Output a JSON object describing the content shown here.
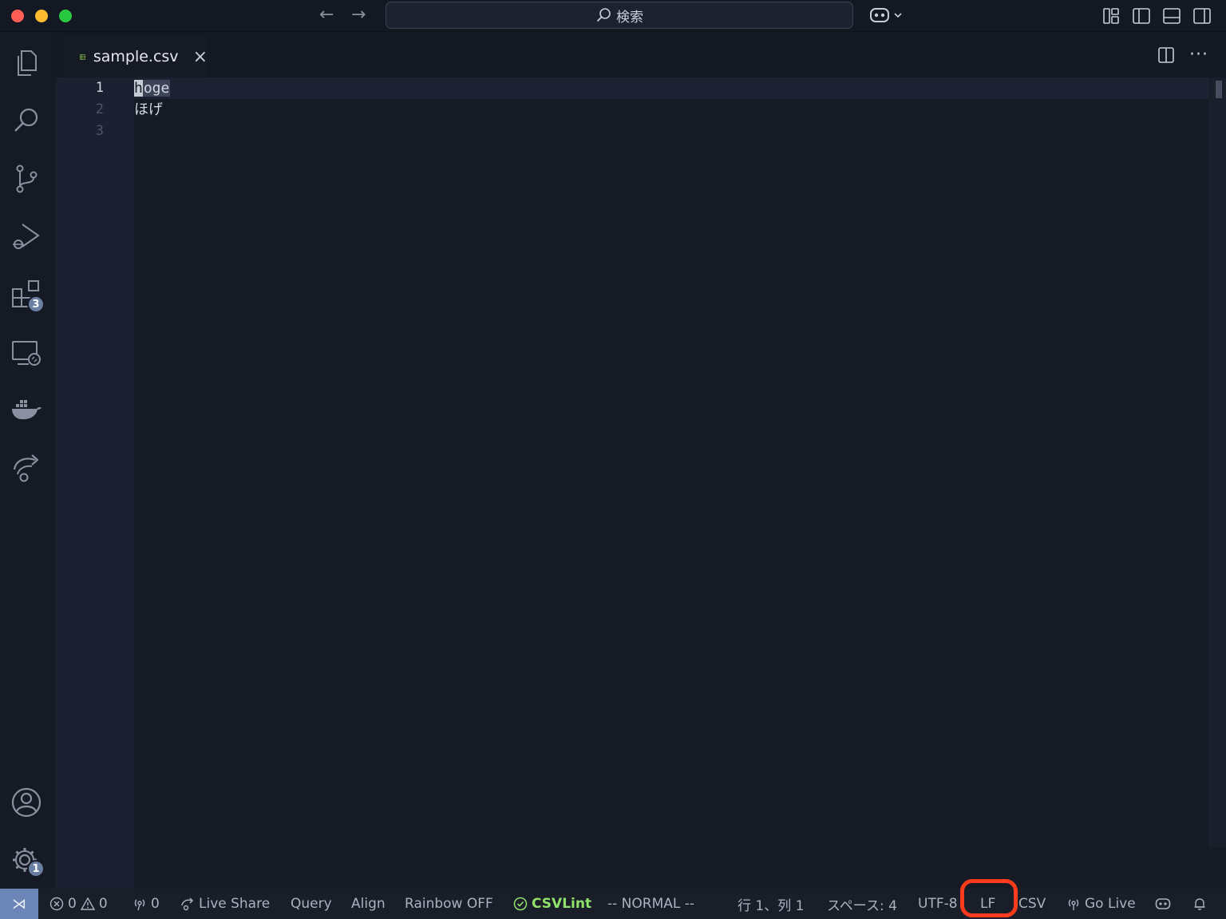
{
  "titlebar": {
    "search_label": "検索",
    "back_icon": "arrow-left-icon",
    "forward_icon": "arrow-right-icon"
  },
  "activity_bar": {
    "items": [
      {
        "name": "explorer",
        "icon": "files-icon"
      },
      {
        "name": "search",
        "icon": "search-icon"
      },
      {
        "name": "source-control",
        "icon": "git-branch-icon"
      },
      {
        "name": "run-debug",
        "icon": "debug-icon"
      },
      {
        "name": "extensions",
        "icon": "extensions-icon",
        "badge": "3"
      },
      {
        "name": "remote-explorer",
        "icon": "remote-explorer-icon"
      },
      {
        "name": "docker",
        "icon": "docker-icon"
      },
      {
        "name": "live-share",
        "icon": "live-share-icon"
      }
    ],
    "bottom": [
      {
        "name": "accounts",
        "icon": "account-icon"
      },
      {
        "name": "manage",
        "icon": "gear-icon",
        "badge": "1"
      }
    ]
  },
  "tab": {
    "label": "sample.csv",
    "close": "×"
  },
  "editor": {
    "lines": [
      {
        "number": "1",
        "cursor_char": "h",
        "selected_rest": "oge"
      },
      {
        "number": "2",
        "text": "ほげ"
      },
      {
        "number": "3",
        "text": ""
      }
    ]
  },
  "statusbar": {
    "errors": "0",
    "warnings": "0",
    "ports": "0",
    "live_share": "Live Share",
    "query": "Query",
    "align": "Align",
    "rainbow": "Rainbow OFF",
    "csvlint": "CSVLint",
    "vim_mode": "-- NORMAL --",
    "position": "行 1、列 1",
    "indent": "スペース: 4",
    "encoding": "UTF-8",
    "eol": "LF",
    "language": "CSV",
    "go_live": "Go Live"
  },
  "colors": {
    "background": "#161a25",
    "accent": "#6b86b6",
    "csvlint_green": "#8fe36a",
    "highlight_red": "#ff3b1e"
  }
}
